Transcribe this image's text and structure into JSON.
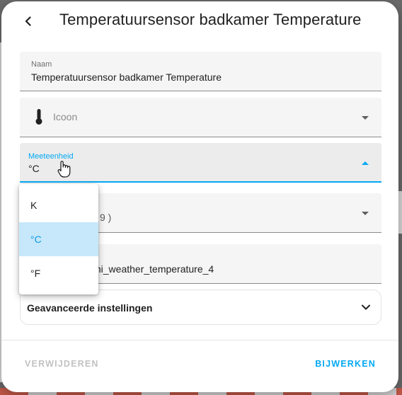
{
  "dialog": {
    "title": "Temperatuursensor badkamer Temperature"
  },
  "fields": {
    "name": {
      "label": "Naam",
      "value": "Temperatuursensor badkamer Temperature"
    },
    "icon": {
      "placeholder": "Icoon"
    },
    "unit": {
      "label": "Meeteenheid",
      "value": "°C"
    },
    "display_precision": {
      "value_partial": "9 )"
    },
    "entity_id": {
      "value_partial": "mi_weather_temperature_4"
    }
  },
  "unit_menu": {
    "options": [
      "K",
      "°C",
      "°F"
    ],
    "selected": "°C"
  },
  "advanced": {
    "label": "Geavanceerde instellingen"
  },
  "actions": {
    "delete_label": "VERWIJDEREN",
    "update_label": "BIJWERKEN"
  },
  "colors": {
    "accent": "#03a9f4",
    "selected_bg": "#c6e8fa",
    "disabled_text": "#c2c2c2"
  },
  "icons": [
    "back-arrow-icon",
    "thermometer-icon",
    "caret-down-icon",
    "caret-up-icon",
    "chevron-down-icon",
    "hand-pointer-cursor"
  ]
}
